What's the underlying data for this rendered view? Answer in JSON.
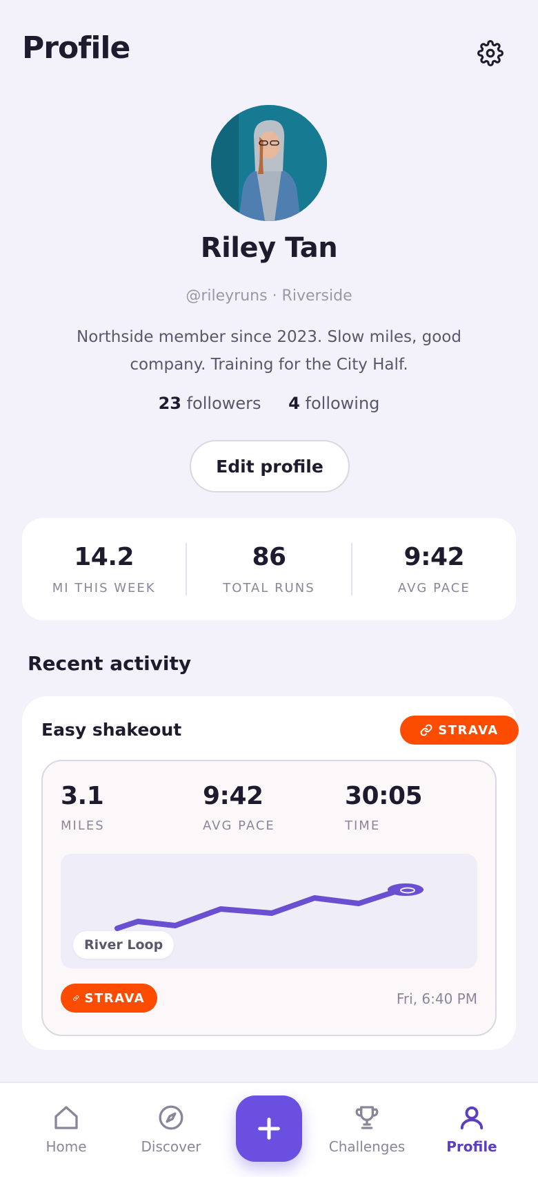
{
  "header": {
    "title": "Profile",
    "settings_icon": "gear-icon"
  },
  "profile": {
    "name": "Riley Tan",
    "handle_location": "@rileyruns · Riverside",
    "bio": "Northside member since 2023. Slow miles, good company. Training for the City Half.",
    "followers_count": "23",
    "followers_label": "followers",
    "following_count": "4",
    "following_label": "following",
    "edit_label": "Edit profile"
  },
  "stats": [
    {
      "value": "14.2",
      "label": "MI THIS WEEK"
    },
    {
      "value": "86",
      "label": "TOTAL RUNS"
    },
    {
      "value": "9:42",
      "label": "AVG PACE"
    }
  ],
  "recent": {
    "section_title": "Recent activity",
    "activity": {
      "title": "Easy shakeout",
      "source_badge": "STRAVA",
      "metrics": [
        {
          "value": "3.1",
          "label": "MILES"
        },
        {
          "value": "9:42",
          "label": "AVG PACE"
        },
        {
          "value": "30:05",
          "label": "TIME"
        }
      ],
      "route_name": "River Loop",
      "timestamp": "Fri, 6:40 PM"
    }
  },
  "tabbar": {
    "items": [
      {
        "label": "Home",
        "icon": "home-icon"
      },
      {
        "label": "Discover",
        "icon": "compass-icon"
      },
      {
        "label": "Challenges",
        "icon": "trophy-icon"
      },
      {
        "label": "Profile",
        "icon": "user-icon"
      }
    ],
    "fab_icon": "plus-icon"
  },
  "colors": {
    "background": "#f3f2fa",
    "accent": "#6a4fe0",
    "strava": "#fc4c02",
    "route": "#6a4fd0"
  }
}
